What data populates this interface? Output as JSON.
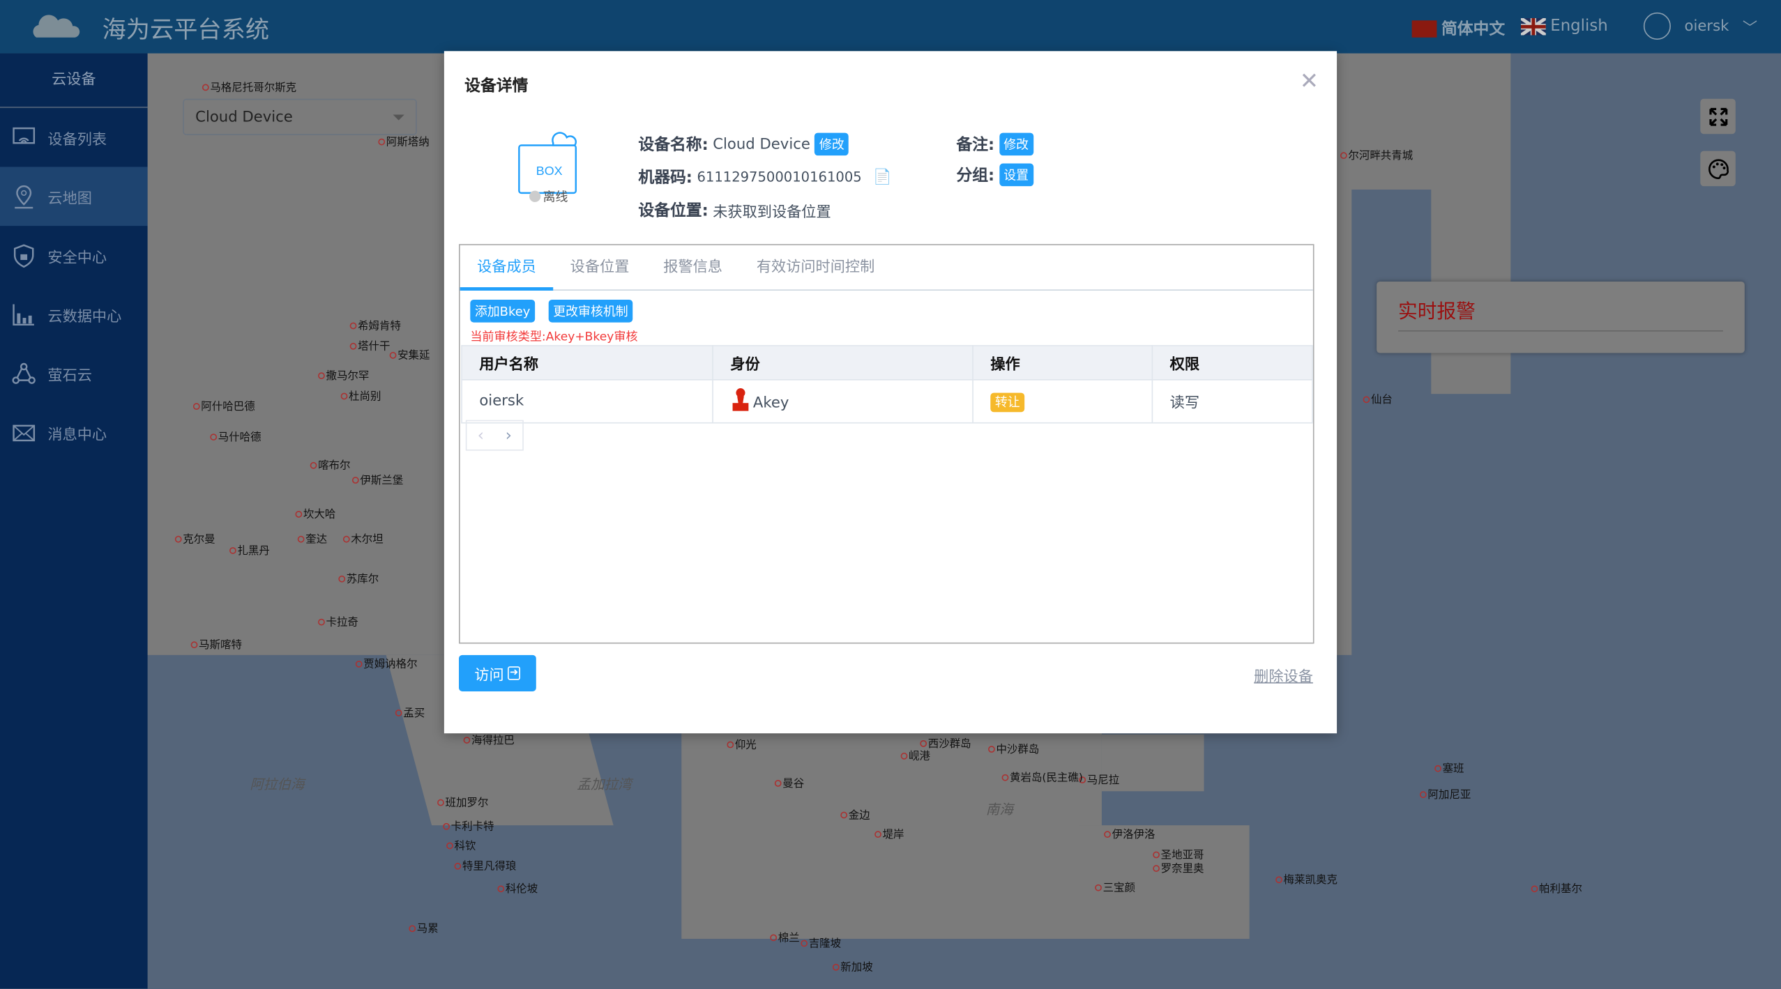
{
  "header": {
    "title": "海为云平台系统",
    "lang_zh": "简体中文",
    "lang_en": "English",
    "username": "oiersk"
  },
  "sidebar": {
    "section": "云设备",
    "items": [
      {
        "label": "设备列表",
        "icon": "device-list-icon"
      },
      {
        "label": "云地图",
        "icon": "map-pin-icon",
        "active": true
      },
      {
        "label": "安全中心",
        "icon": "shield-lock-icon"
      },
      {
        "label": "云数据中心",
        "icon": "bar-chart-icon"
      },
      {
        "label": "萤石云",
        "icon": "network-icon"
      },
      {
        "label": "消息中心",
        "icon": "mail-icon"
      }
    ]
  },
  "map": {
    "device_select": "Cloud Device",
    "alarm_title": "实时报警",
    "cities": [
      "马格尼托哥尔斯克",
      "阿斯塔纳",
      "希姆肯特",
      "塔什干",
      "安集延",
      "撒马尔罕",
      "杜尚别",
      "阿什哈巴德",
      "马什哈德",
      "喀布尔",
      "伊斯兰堡",
      "坎大哈",
      "奎达",
      "克尔曼",
      "扎黑丹",
      "木尔坦",
      "苏库尔",
      "卡拉奇",
      "马斯喀特",
      "贾姆讷格尔",
      "孟买",
      "海得拉巴",
      "班加罗尔",
      "卡利卡特",
      "科钦",
      "特里凡得琅",
      "科伦坡",
      "马累",
      "仰光",
      "岘港",
      "曼谷",
      "金边",
      "堤岸",
      "马尼拉",
      "伊洛伊洛",
      "三宝颜",
      "圣地亚哥",
      "罗奈里奥",
      "棉兰",
      "吉隆坡",
      "新加坡",
      "塞班",
      "阿加尼亚",
      "梅莱凯奥克",
      "帕利基尔",
      "仙台",
      "尔河畔共青城",
      "西沙群岛",
      "中沙群岛",
      "黄岩岛(民主礁)"
    ],
    "seas": [
      "阿拉伯海",
      "孟加拉湾",
      "南海"
    ]
  },
  "dialog": {
    "title": "设备详情",
    "box_label": "BOX",
    "status": "离线",
    "name_label": "设备名称:",
    "name_value": "Cloud Device",
    "edit": "修改",
    "code_label": "机器码:",
    "code_value": "6111297500010161005",
    "location_label": "设备位置:",
    "location_value": "未获取到设备位置",
    "remark_label": "备注:",
    "group_label": "分组:",
    "group_set": "设置",
    "tabs": [
      "设备成员",
      "设备位置",
      "报警信息",
      "有效访问时间控制"
    ],
    "add_bkey": "添加Bkey",
    "change_audit": "更改审核机制",
    "audit_type": "当前审核类型:Akey+Bkey审核",
    "columns": [
      "用户名称",
      "身份",
      "操作",
      "权限"
    ],
    "rows": [
      {
        "user": "oiersk",
        "role": "Akey",
        "action": "转让",
        "permission": "读写"
      }
    ],
    "visit": "访问",
    "delete": "删除设备"
  }
}
